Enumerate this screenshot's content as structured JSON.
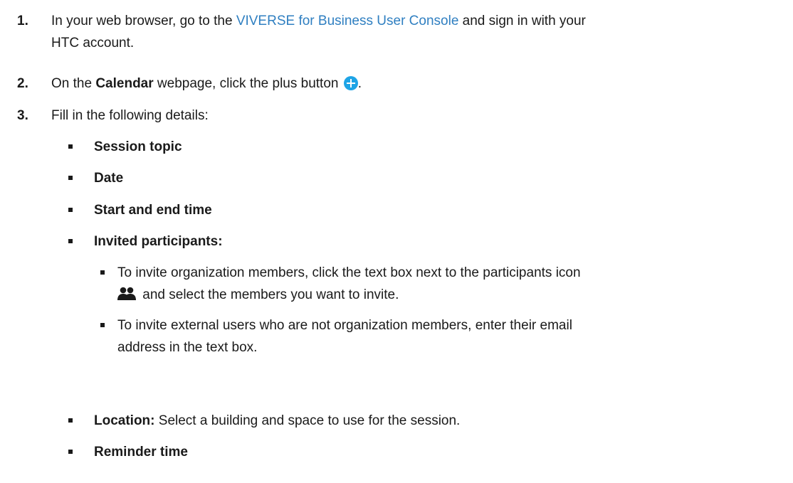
{
  "steps": [
    {
      "num": "1.",
      "pre": "In your web browser, go to the ",
      "link": "VIVERSE for Business User Console",
      "post_line1": " and sign in with your",
      "post_line2": "HTC account."
    },
    {
      "num": "2.",
      "pre": "On the ",
      "bold": "Calendar",
      "post": " webpage, click the plus button",
      "end": "."
    },
    {
      "num": "3.",
      "text": "Fill in the following details:"
    }
  ],
  "details": {
    "session_topic": "Session topic",
    "date": "Date",
    "start_end_time": "Start and end time",
    "invited_participants": "Invited participants:",
    "location_label": "Location:",
    "location_text": " Select a building and space to use for the session.",
    "reminder_time": "Reminder time"
  },
  "participants_sub": [
    {
      "line1": "To invite organization members, click the text box next to the participants icon",
      "line2": " and select the members you want to invite."
    },
    {
      "line1": "To invite external users who are not organization members, enter their email",
      "line2": "address in the text box."
    }
  ],
  "colors": {
    "link": "#2f7fc1",
    "plus_icon": "#1ea4e6",
    "text": "#1a1a1a"
  },
  "icons": {
    "plus": "plus-circle-icon",
    "participants": "participants-icon"
  }
}
